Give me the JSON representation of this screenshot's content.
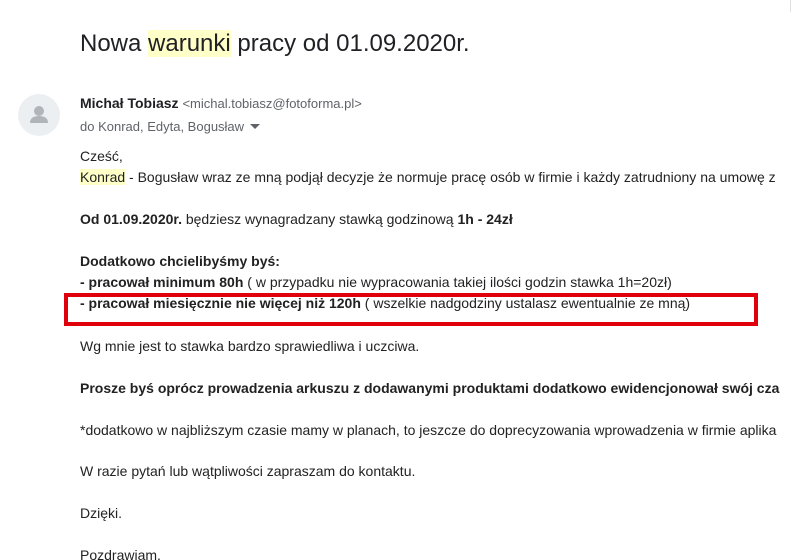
{
  "subject": {
    "before": "Nowa ",
    "highlight": "warunki",
    "after": " pracy od 01.09.2020r."
  },
  "sender": {
    "name": "Michał Tobiasz",
    "email": "<michal.tobiasz@fotoforma.pl>",
    "recipients": "do Konrad, Edyta, Bogusław"
  },
  "body": {
    "greeting": "Cześć,",
    "line1_name": "Konrad",
    "line1_rest": " - Bogusław wraz ze mną podjął decyzje że normuje pracę osób w firmie i każdy zatrudniony na umowę z",
    "line2_bold": "Od 01.09.2020r.",
    "line2_mid": " będziesz wynagradzany stawką godzinową ",
    "line2_rate": "1h - 24zł",
    "line3": "Dodatkowo chcielibyśmy byś:",
    "line4_bold": "- pracował minimum 80h",
    "line4_rest": " ( w przypadku nie wypracowania takiej ilości godzin stawka 1h=20zł)",
    "line5_bold": "- pracował miesięcznie nie więcej niż 120h",
    "line5_rest": " ( wszelkie nadgodziny ustalasz ewentualnie ze mną)",
    "line6": "Wg mnie jest to stawka bardzo sprawiedliwa i uczciwa.",
    "line7": "Prosze byś oprócz prowadzenia arkuszu z dodawanymi produktami dodatkowo ewidencjonował swój cza",
    "line8": "*dodatkowo w najbliższym czasie mamy w planach, to jeszcze do doprecyzowania wprowadzenia w firmie aplika",
    "line9": "W razie pytań lub wątpliwości zapraszam do kontaktu.",
    "line10": "Dzięki.",
    "line11": "Pozdrawiam,"
  },
  "colors": {
    "highlight": "#ffffc8",
    "annotation_box": "#e0000c"
  }
}
